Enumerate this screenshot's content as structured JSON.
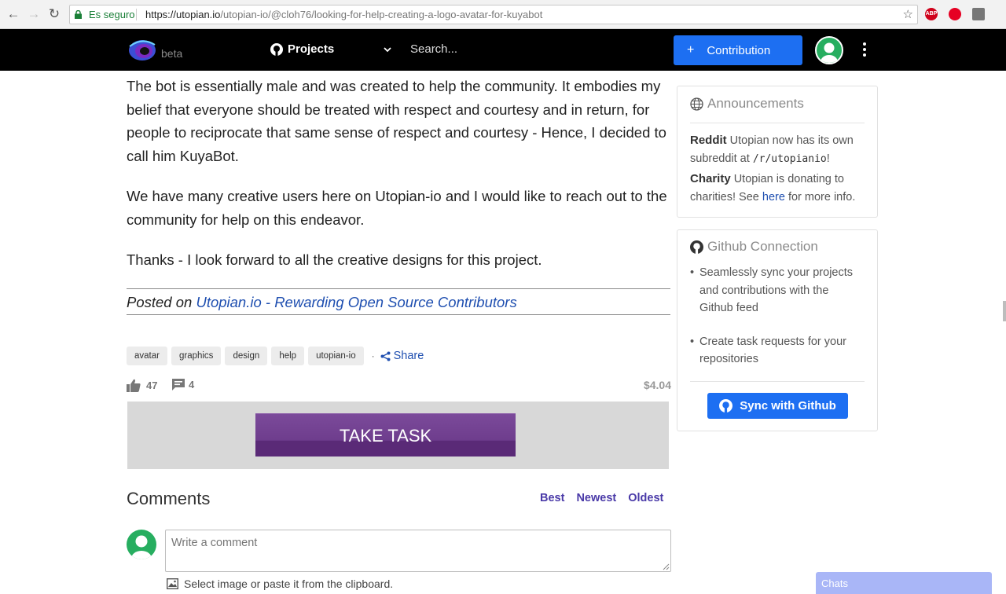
{
  "browser": {
    "secure_label": "Es seguro",
    "url_host": "https://utopian.io",
    "url_path": "/utopian-io/@cloh76/looking-for-help-creating-a-logo-avatar-for-kuyabot"
  },
  "header": {
    "beta_label": "beta",
    "projects_label": "Projects",
    "search_placeholder": "Search...",
    "contribution_label": "Contribution",
    "plus_glyph": "+"
  },
  "article": {
    "paragraphs": [
      "The bot is essentially male and was created to help the community. It embodies my belief that everyone should be treated with respect and courtesy and in return, for people to reciprocate that same sense of respect and courtesy - Hence, I decided to call him KuyaBot.",
      "We have many creative users here on Utopian-io and I would like to reach out to the community for help on this endeavor.",
      "Thanks - I look forward to all the creative designs for this project."
    ],
    "posted_prefix": "Posted on ",
    "posted_link": "Utopian.io - Rewarding Open Source Contributors"
  },
  "tags": [
    "avatar",
    "graphics",
    "design",
    "help",
    "utopian-io"
  ],
  "tag_separator": "·",
  "share_label": "Share",
  "stats": {
    "likes": "47",
    "comments": "4",
    "payout": "$4.04"
  },
  "take_task_label": "TAKE TASK",
  "comments": {
    "heading": "Comments",
    "sort_best": "Best",
    "sort_newest": "Newest",
    "sort_oldest": "Oldest",
    "placeholder": "Write a comment",
    "image_hint": "Select image or paste it from the clipboard."
  },
  "announcements": {
    "title": "Announcements",
    "reddit_label": "Reddit",
    "reddit_text_1": "Utopian now has its own subreddit at ",
    "reddit_code": "/r/utopianio",
    "reddit_text_2": "!",
    "charity_label": "Charity",
    "charity_text_1": "Utopian is donating to charities! See ",
    "charity_link": "here",
    "charity_text_2": " for more info."
  },
  "github": {
    "title": "Github Connection",
    "items": [
      "Seamlessly sync your projects and contributions with the Github feed",
      "Create task requests for your repositories"
    ],
    "sync_label": "Sync with Github"
  },
  "chats_label": "Chats",
  "colors": {
    "brand_blue": "#1d6ff2",
    "task_purple": "#6e3d8d",
    "avatar_green": "#27ae60",
    "link_blue": "#1f4fb0"
  }
}
